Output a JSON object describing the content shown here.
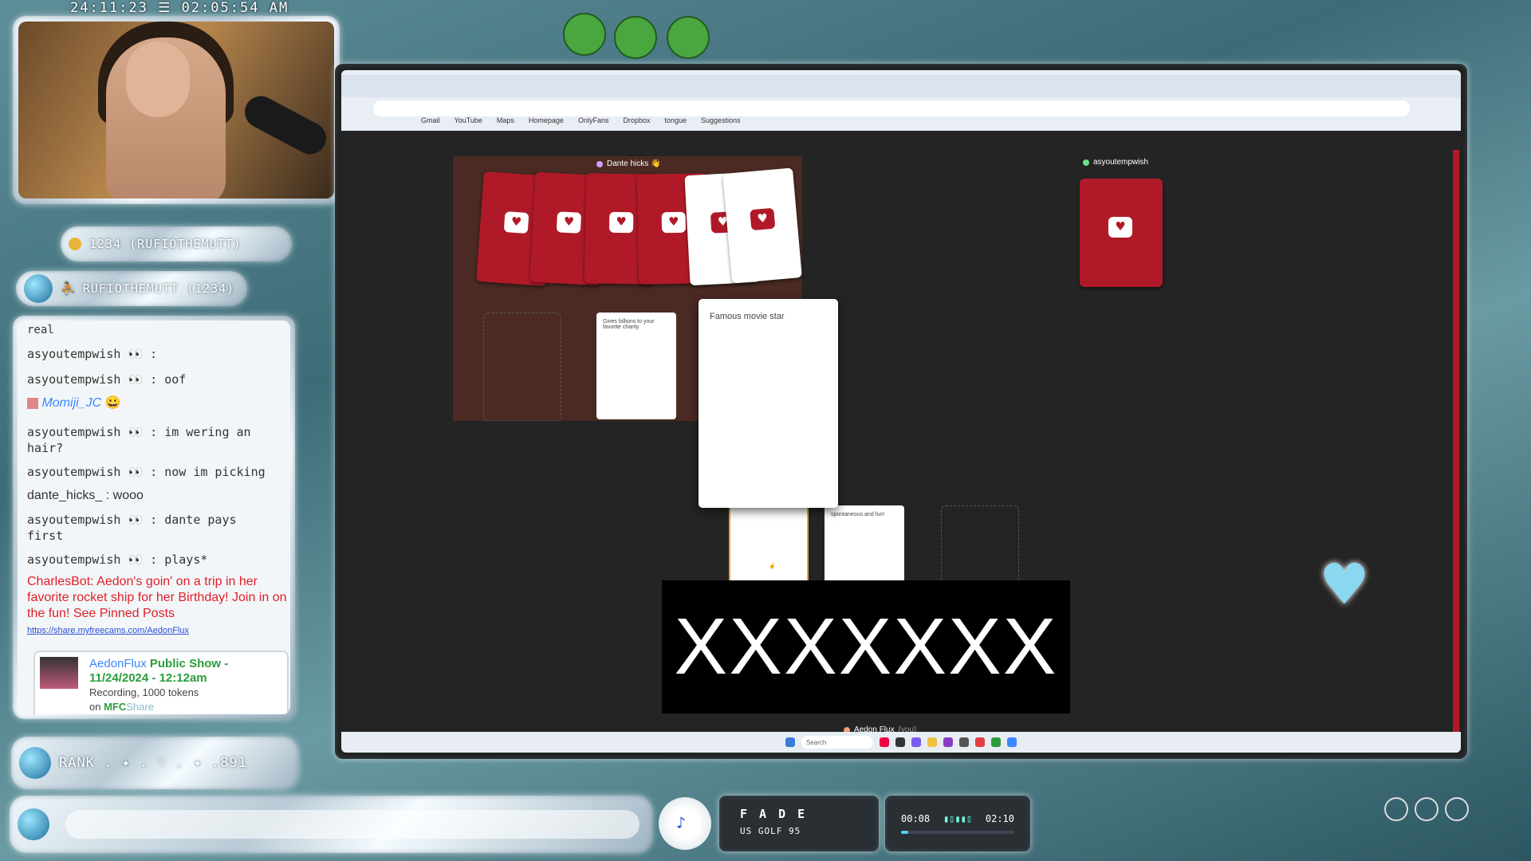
{
  "overlay": {
    "timestamp": "24:11:23 ☰ 02:05:54 AM",
    "top_fan": "1234 (RUFIOTHEMUTT)",
    "latest_follower": "RUFIOTHEMUTT (1234)",
    "rank_label": "RANK . ✦ . ♡ . ✦ .891"
  },
  "chat": {
    "header_partial": "real",
    "messages": [
      {
        "user": "asyoutempwish",
        "text": "👀 :"
      },
      {
        "user": "asyoutempwish",
        "text": "👀 : oof"
      },
      {
        "user": "Momiji_JC",
        "text": "😀"
      },
      {
        "user": "asyoutempwish",
        "text": "👀 : im wering an hair?"
      },
      {
        "user": "asyoutempwish",
        "text": "👀 : now im picking"
      },
      {
        "user": "dante_hicks_",
        "text": ": wooo"
      },
      {
        "user": "asyoutempwish",
        "text": "👀 : dante pays first"
      },
      {
        "user": "asyoutempwish",
        "text": "👀 : plays*"
      }
    ],
    "bot_message": {
      "user": "CharlesBot",
      "text": ": Aedon's goin' on a trip in her favorite rocket ship for her Birthday! Join in on the fun! See Pinned Posts",
      "link": "https://share.myfreecams.com/AedonFlux"
    },
    "recording_card": {
      "name": "AedonFlux",
      "title": "Public Show - 11/24/2024 - 12:12am",
      "detail": "Recording, 1000 tokens",
      "on_label": "on",
      "brand": "MFC",
      "brand2": "Share"
    }
  },
  "browser": {
    "bookmarks": [
      "Gmail",
      "YouTube",
      "Maps",
      "Homepage",
      "OnlyFans",
      "Dropbox",
      "tongue",
      "Suggestions"
    ]
  },
  "game": {
    "player_top_left": "Dante hicks 👋",
    "player_top_right": "asyoutempwish",
    "player_bottom": "Aedon Flux",
    "player_bottom_suffix": "(you)",
    "small_card_1": "Gives billions to your favorite charity",
    "small_card_2": "spontaneous and fun!",
    "big_card": "Famous movie star",
    "censor_text": "XXXXXXX",
    "taskbar_search": "Search"
  },
  "music": {
    "artist": "F A D E",
    "track": "US GOLF 95",
    "elapsed": "00:08",
    "total": "02:10",
    "progress": 0.06
  }
}
